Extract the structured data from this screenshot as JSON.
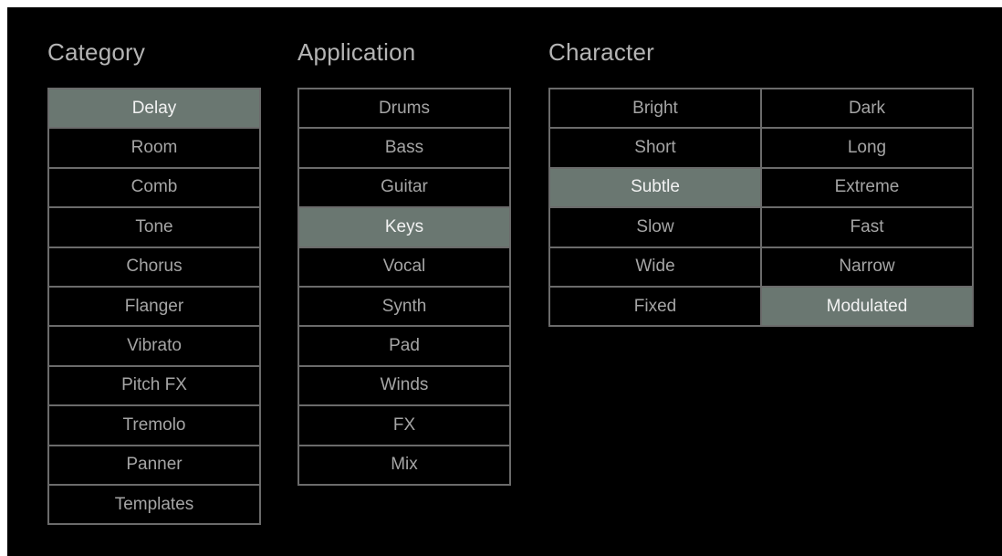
{
  "colors": {
    "background": "#000000",
    "border": "#6b6b6b",
    "selected_bg": "#6a7771",
    "text": "#a5a5a5",
    "selected_text": "#f2f2f2",
    "heading": "#b4b4b4"
  },
  "category": {
    "title": "Category",
    "items": [
      {
        "label": "Delay",
        "selected": true
      },
      {
        "label": "Room",
        "selected": false
      },
      {
        "label": "Comb",
        "selected": false
      },
      {
        "label": "Tone",
        "selected": false
      },
      {
        "label": "Chorus",
        "selected": false
      },
      {
        "label": "Flanger",
        "selected": false
      },
      {
        "label": "Vibrato",
        "selected": false
      },
      {
        "label": "Pitch FX",
        "selected": false
      },
      {
        "label": "Tremolo",
        "selected": false
      },
      {
        "label": "Panner",
        "selected": false
      },
      {
        "label": "Templates",
        "selected": false
      }
    ]
  },
  "application": {
    "title": "Application",
    "items": [
      {
        "label": "Drums",
        "selected": false
      },
      {
        "label": "Bass",
        "selected": false
      },
      {
        "label": "Guitar",
        "selected": false
      },
      {
        "label": "Keys",
        "selected": true
      },
      {
        "label": "Vocal",
        "selected": false
      },
      {
        "label": "Synth",
        "selected": false
      },
      {
        "label": "Pad",
        "selected": false
      },
      {
        "label": "Winds",
        "selected": false
      },
      {
        "label": "FX",
        "selected": false
      },
      {
        "label": "Mix",
        "selected": false
      }
    ]
  },
  "character": {
    "title": "Character",
    "items": [
      {
        "label": "Bright",
        "selected": false
      },
      {
        "label": "Dark",
        "selected": false
      },
      {
        "label": "Short",
        "selected": false
      },
      {
        "label": "Long",
        "selected": false
      },
      {
        "label": "Subtle",
        "selected": true
      },
      {
        "label": "Extreme",
        "selected": false
      },
      {
        "label": "Slow",
        "selected": false
      },
      {
        "label": "Fast",
        "selected": false
      },
      {
        "label": "Wide",
        "selected": false
      },
      {
        "label": "Narrow",
        "selected": false
      },
      {
        "label": "Fixed",
        "selected": false
      },
      {
        "label": "Modulated",
        "selected": true
      }
    ]
  }
}
